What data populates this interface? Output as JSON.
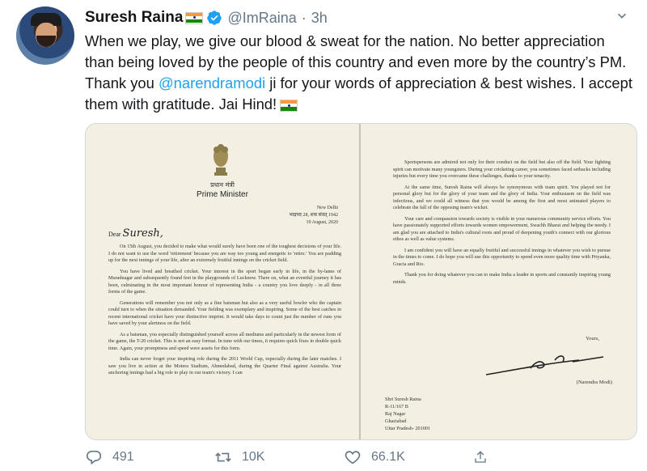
{
  "tweet": {
    "author_name": "Suresh Raina",
    "handle": "@ImRaina",
    "separator": "·",
    "time": "3h",
    "text_part1": "When we play, we give our blood & sweat for the nation. No better appreciation than being loved by the people of this country and even more by the country’s PM. Thank you ",
    "mention": "@narendramodi",
    "text_part2": " ji for your words of appreciation & best wishes. I accept them with gratitude. Jai Hind!"
  },
  "letter": {
    "hindi_title": "प्रधान मंत्री",
    "title": "Prime Minister",
    "date_lines": [
      "New Delhi",
      "भाद्रपद 28, शक संवत् 1942",
      "19 August, 2020"
    ],
    "salutation": "Dear",
    "salutation_name": "Suresh,",
    "left_paragraphs": [
      "On 15th August, you decided to make what would surely have been one of the toughest decisions of your life. I do not want to use the word 'retirement' because you are way too young and energetic to 'retire.' You are padding up for the next innings of your life, after an extremely fruitful innings on the cricket field.",
      "You have lived and breathed cricket. Your interest in the sport began early in life, in the by-lanes of Muradnagar and subsequently found feet in the playgrounds of Lucknow. There on, what an eventful journey it has been, culminating in the most important honour of representing India - a country you love deeply - in all three forms of the game.",
      "Generations will remember you not only as a fine batsman but also as a very useful bowler who the captain could turn to when the situation demanded. Your fielding was exemplary and inspiring. Some of the best catches in recent international cricket have your distinctive imprint. It would take days to count just the number of runs you have saved by your alertness on the field.",
      "As a batsman, you especially distinguished yourself across all mediums and particularly in the newest form of the game, the T-20 cricket. This is not an easy format. In tune with our times, it requires quick fixes in double quick time. Again, your promptness and speed were assets for this form.",
      "India can never forget your inspiring role during the 2011 World Cup, especially during the later matches. I saw you live in action at the Motera Stadium, Ahmedabad, during the Quarter Final against Australia. Your anchoring innings had a big role to play in our team's victory. I can"
    ],
    "right_paragraphs": [
      "Sportspersons are admired not only for their conduct on the field but also off the field. Your fighting spirit can motivate many youngsters. During your cricketing career, you sometimes faced setbacks including injuries but every time you overcame these challenges, thanks to your tenacity.",
      "At the same time, Suresh Raina will always be synonymous with team spirit. You played not for personal glory but for the glory of your team and the glory of India. Your enthusiasm on the field was infectious, and we could all witness that you would be among the first and most animated players to celebrate the fall of the opposing team's wicket.",
      "Your care and compassion towards society is visible in your numerous community service efforts. You have passionately supported efforts towards women empowerment, Swachh Bharat and helping the needy. I am glad you are attached to India's cultural roots and proud of deepening youth's connect with our glorious ethos as well as value systems.",
      "I am confident you will have an equally fruitful and successful innings in whatever you wish to pursue in the times to come. I do hope you will use this opportunity to spend even more quality time with Priyanka, Gracia and Rio.",
      "Thank you for doing whatever you can to make India a leader in sports and constantly inspiring young minds."
    ],
    "closing": "Yours,",
    "signatory": "(Narendra Modi)",
    "address_lines": [
      "Shri Suresh Raina",
      "R-11/167 B",
      "Raj Nagar",
      "Ghaziabad",
      "Uttar Pradesh- 201001"
    ]
  },
  "actions": {
    "replies": "491",
    "retweets": "10K",
    "likes": "66.1K"
  },
  "colors": {
    "link": "#1da1f2",
    "muted": "#657786",
    "verified": "#1da1f2"
  },
  "icons": [
    "verified-badge-icon",
    "chevron-down-icon",
    "reply-icon",
    "retweet-icon",
    "like-icon",
    "share-icon"
  ]
}
